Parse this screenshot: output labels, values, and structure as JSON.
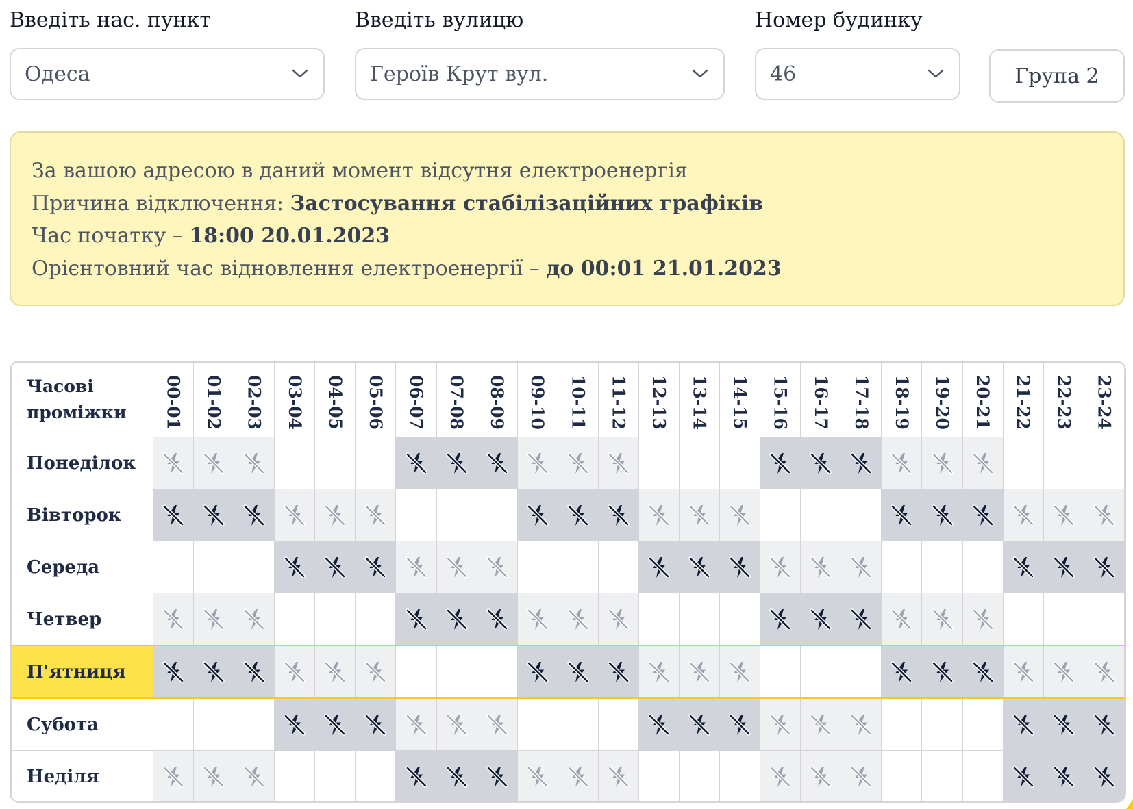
{
  "filters": {
    "settlement_label": "Введіть нас. пункт",
    "settlement_value": "Одеса",
    "street_label": "Введіть вулицю",
    "street_value": "Героїв Крут вул.",
    "house_label": "Номер будинку",
    "house_value": "46",
    "group_label": "Група 2"
  },
  "notice": {
    "line1": "За вашою адресою в даний момент відсутня електроенергія",
    "reason_prefix": "Причина відключення: ",
    "reason_value": "Застосування стабілізаційних графіків",
    "start_prefix": "Час початку – ",
    "start_value": "18:00 20.01.2023",
    "restore_prefix": "Орієнтовний час відновлення електроенергії – ",
    "restore_value": "до 00:01 21.01.2023"
  },
  "schedule": {
    "header_line1": "Часові",
    "header_line2": "проміжки",
    "hours": [
      "00-01",
      "01-02",
      "02-03",
      "03-04",
      "04-05",
      "05-06",
      "06-07",
      "07-08",
      "08-09",
      "09-10",
      "10-11",
      "11-12",
      "12-13",
      "13-14",
      "14-15",
      "15-16",
      "16-17",
      "17-18",
      "18-19",
      "19-20",
      "20-21",
      "21-22",
      "22-23",
      "23-24"
    ],
    "days": [
      {
        "name": "Понеділок",
        "today": false,
        "slots": [
          "maybe",
          "maybe",
          "maybe",
          "on",
          "on",
          "on",
          "off",
          "off",
          "off",
          "maybe",
          "maybe",
          "maybe",
          "on",
          "on",
          "on",
          "off",
          "off",
          "off",
          "maybe",
          "maybe",
          "maybe",
          "on",
          "on",
          "on"
        ]
      },
      {
        "name": "Вівторок",
        "today": false,
        "slots": [
          "off",
          "off",
          "off",
          "maybe",
          "maybe",
          "maybe",
          "on",
          "on",
          "on",
          "off",
          "off",
          "off",
          "maybe",
          "maybe",
          "maybe",
          "on",
          "on",
          "on",
          "off",
          "off",
          "off",
          "maybe",
          "maybe",
          "maybe"
        ]
      },
      {
        "name": "Середа",
        "today": false,
        "slots": [
          "on",
          "on",
          "on",
          "off",
          "off",
          "off",
          "maybe",
          "maybe",
          "maybe",
          "on",
          "on",
          "on",
          "off",
          "off",
          "off",
          "maybe",
          "maybe",
          "maybe",
          "on",
          "on",
          "on",
          "off",
          "off",
          "off"
        ]
      },
      {
        "name": "Четвер",
        "today": false,
        "slots": [
          "maybe",
          "maybe",
          "maybe",
          "on",
          "on",
          "on",
          "off",
          "off",
          "off",
          "maybe",
          "maybe",
          "maybe",
          "on",
          "on",
          "on",
          "off",
          "off",
          "off",
          "maybe",
          "maybe",
          "maybe",
          "on",
          "on",
          "on"
        ]
      },
      {
        "name": "П'ятниця",
        "today": true,
        "slots": [
          "off",
          "off",
          "off",
          "maybe",
          "maybe",
          "maybe",
          "on",
          "on",
          "on",
          "off",
          "off",
          "off",
          "maybe",
          "maybe",
          "maybe",
          "on",
          "on",
          "on",
          "off",
          "off",
          "off",
          "maybe",
          "maybe",
          "maybe"
        ]
      },
      {
        "name": "Субота",
        "today": false,
        "slots": [
          "on",
          "on",
          "on",
          "off",
          "off",
          "off",
          "maybe",
          "maybe",
          "maybe",
          "on",
          "on",
          "on",
          "off",
          "off",
          "off",
          "maybe",
          "maybe",
          "maybe",
          "on",
          "on",
          "on",
          "off",
          "off",
          "off"
        ]
      },
      {
        "name": "Неділя",
        "today": false,
        "slots": [
          "maybe",
          "maybe",
          "maybe",
          "on",
          "on",
          "on",
          "off",
          "off",
          "off",
          "maybe",
          "maybe",
          "maybe",
          "on",
          "on",
          "on",
          "maybe",
          "maybe",
          "maybe",
          "on",
          "on",
          "on",
          "off",
          "off",
          "off"
        ]
      }
    ],
    "legend_icons": {
      "off": "no-power-icon",
      "maybe": "possible-outage-icon",
      "on": "power-on"
    }
  },
  "colors": {
    "notice_bg": "#fef6bd",
    "today_bg": "#fde24a",
    "off_bg": "#d1d5db",
    "maybe_bg": "#eef0f2",
    "icon_dark": "#111b33",
    "icon_light": "#9ca3af"
  }
}
